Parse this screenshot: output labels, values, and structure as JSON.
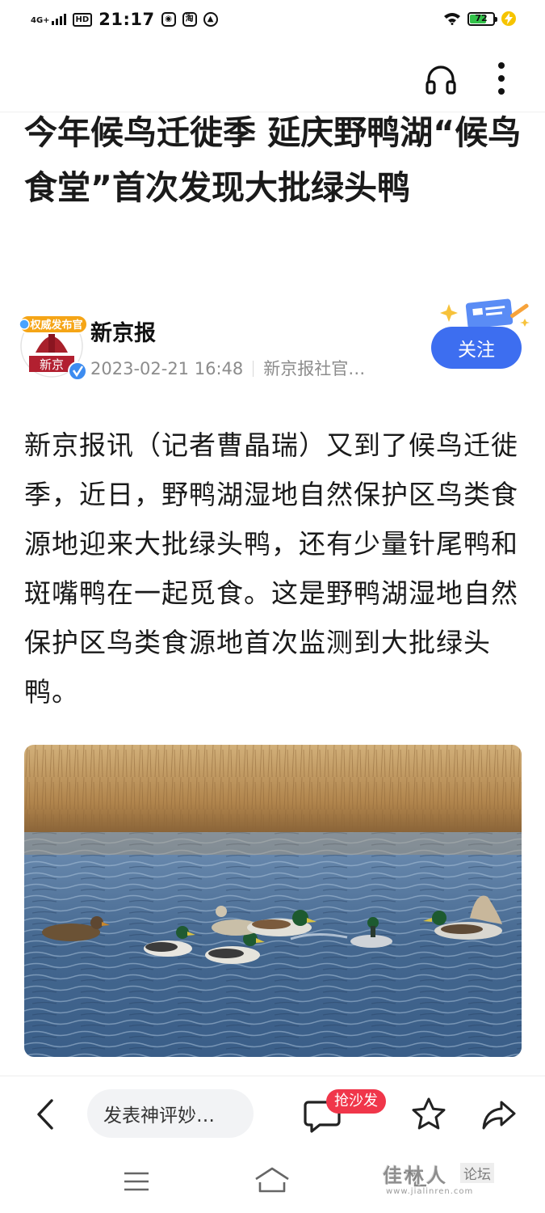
{
  "status_bar": {
    "network": "4G+",
    "hd": "HD",
    "time": "21:17",
    "app_icon_2": "淘",
    "battery_level": "72",
    "battery_fraction": 0.72,
    "battery_color": "#33c24a"
  },
  "top_bar": {
    "icons": [
      "headphone-icon",
      "more-icon"
    ]
  },
  "article": {
    "title": "今年候鸟迁徙季 延庆野鸭湖“候鸟食堂”首次发现大批绿头鸭",
    "body": "新京报讯（记者曹晶瑞）又到了候鸟迁徙季，近日，野鸭湖湿地自然保护区鸟类食源地迎来大批绿头鸭，还有少量针尾鸭和斑嘴鸭在一起觅食。这是野鸭湖湿地自然保护区鸟类食源地首次监测到大批绿头鸭。"
  },
  "author": {
    "badge_text": "权威发布官",
    "avatar_text": "新京",
    "name": "新京报",
    "date": "2023-02-21 16:48",
    "account": "新京报社官…",
    "follow_label": "关注",
    "accent_color": "#3d6ef0"
  },
  "bottom_bar": {
    "comment_placeholder": "发表神评妙…",
    "sofa_badge": "抢沙发",
    "badge_color": "#f0364a"
  },
  "watermark": {
    "main": "佳林人",
    "tag": "论坛",
    "sub": "www.jialinren.com"
  }
}
